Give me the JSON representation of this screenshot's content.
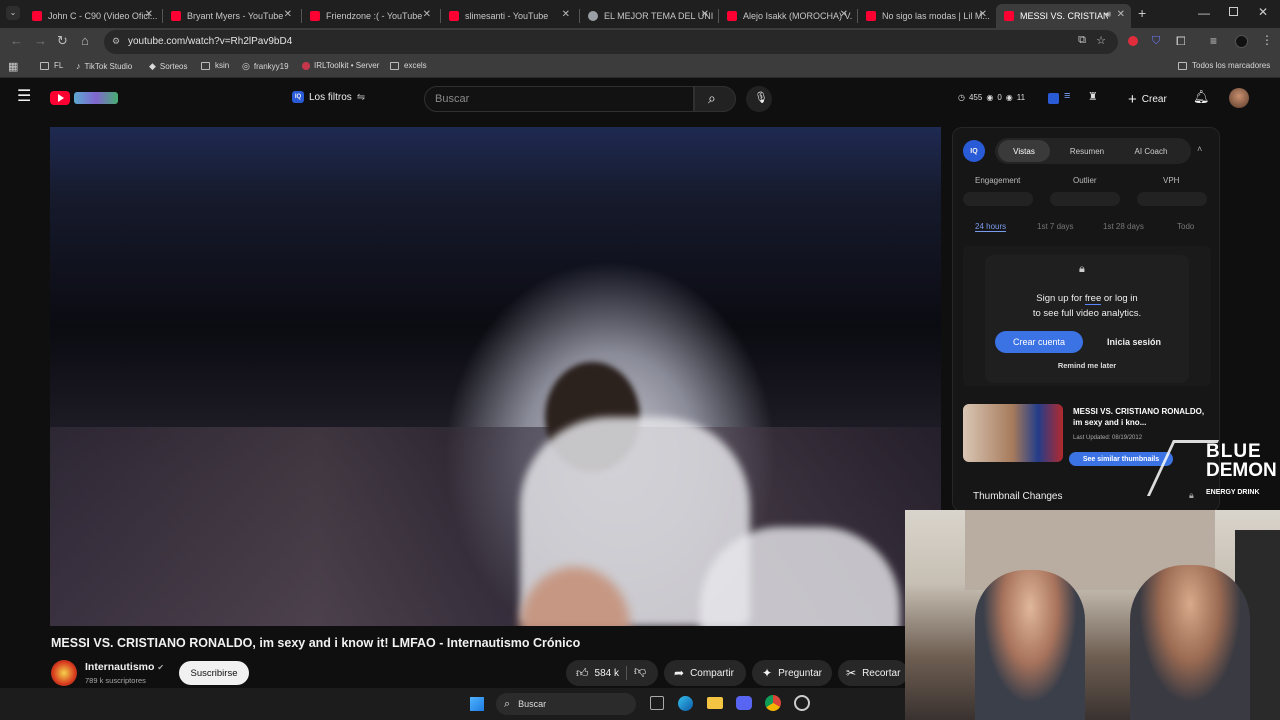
{
  "browser": {
    "tabs": [
      {
        "title": "John C - C90 (Video Ofici...",
        "color": "#ff0033"
      },
      {
        "title": "Bryant Myers - YouTube",
        "color": "#ff0033"
      },
      {
        "title": "Friendzone :( - YouTube",
        "color": "#ff0033"
      },
      {
        "title": "slimesanti - YouTube",
        "color": "#ff0033"
      },
      {
        "title": "EL MEJOR TEMA DEL UNI...",
        "color": "#9aa0a6"
      },
      {
        "title": "Alejo Isakk (MOROCHA) V...",
        "color": "#ff0033"
      },
      {
        "title": "No sigo las modas | Lil M...",
        "color": "#ff0033"
      },
      {
        "title": "MESSI VS. CRISTIANO...",
        "color": "#ff0033"
      }
    ],
    "url": "youtube.com/watch?v=Rh2lPav9bD4",
    "bookmarks": [
      "FL",
      "TikTok Studio",
      "Sorteos",
      "ksin",
      "frankyy19",
      "IRLToolkit • Server",
      "excels"
    ],
    "all_bookmarks": "Todos los marcadores"
  },
  "youtube": {
    "filters_label": "Los filtros",
    "search_placeholder": "Buscar",
    "stats": {
      "views": "455",
      "a": "0",
      "b": "11"
    },
    "create_label": "Crear"
  },
  "iq": {
    "tabs": [
      "Vistas",
      "Resumen",
      "AI Coach"
    ],
    "metrics": [
      "Engagement",
      "Outlier",
      "VPH"
    ],
    "periods": [
      "24 hours",
      "1st 7 days",
      "1st 28 days",
      "Todo"
    ],
    "signup_text_1": "Sign up for",
    "signup_free": "free",
    "signup_text_2": "or log in",
    "signup_text_3": "to see full video analytics.",
    "create_account": "Crear cuenta",
    "login": "Inicia sesión",
    "remind": "Remind me later",
    "thumb_title": "MESSI VS. CRISTIANO RONALDO, im sexy and i kno...",
    "last_updated": "Last Updated: 08/19/2012",
    "similar": "See similar thumbnails",
    "thumb_changes": "Thumbnail Changes"
  },
  "video": {
    "title": "MESSI VS. CRISTIANO RONALDO, im sexy and i know it! LMFAO - Internautismo Crónico",
    "channel": "Internautismo",
    "subscribers": "789 k suscriptores",
    "subscribe": "Suscribirse",
    "likes": "584 k",
    "share": "Compartir",
    "ask": "Preguntar",
    "clip": "Recortar"
  },
  "overlay": {
    "brand_line1": "BLUE",
    "brand_line2": "DEMON",
    "brand_sub": "ENERGY DRINK"
  },
  "taskbar": {
    "search": "Buscar"
  }
}
